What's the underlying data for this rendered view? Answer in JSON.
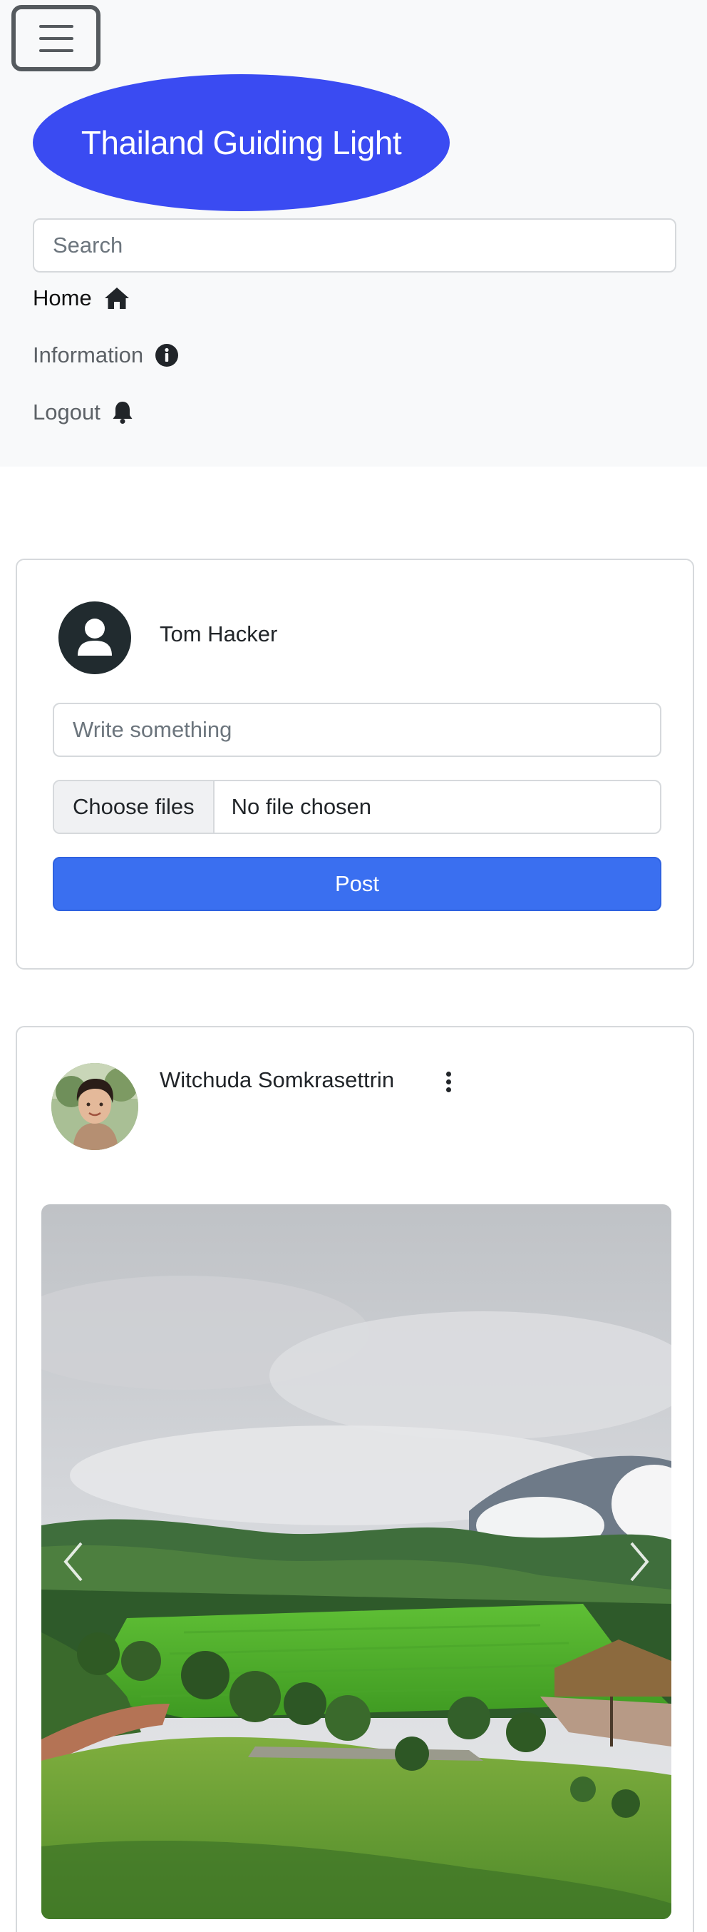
{
  "navbar": {
    "brand": "Thailand Guiding Light",
    "search_placeholder": "Search",
    "items": [
      {
        "label": "Home",
        "icon": "home-icon",
        "active": true
      },
      {
        "label": "Information",
        "icon": "info-circle-icon",
        "active": false
      },
      {
        "label": "Logout",
        "icon": "bell-icon",
        "active": false
      }
    ]
  },
  "composer": {
    "user_name": "Tom Hacker",
    "text_placeholder": "Write something",
    "file_button_label": "Choose files",
    "file_status": "No file chosen",
    "post_button_label": "Post"
  },
  "post": {
    "author_name": "Witchuda Somkrasettrin",
    "menu_icon": "more-vertical-icon",
    "image_description_icon": "landscape-photo",
    "carousel_prev_icon": "chevron-left-icon",
    "carousel_next_icon": "chevron-right-icon"
  },
  "colors": {
    "brand_bg": "#3a4bf2",
    "primary": "#3a6ff0",
    "navbar_bg": "#f8f9fa"
  }
}
